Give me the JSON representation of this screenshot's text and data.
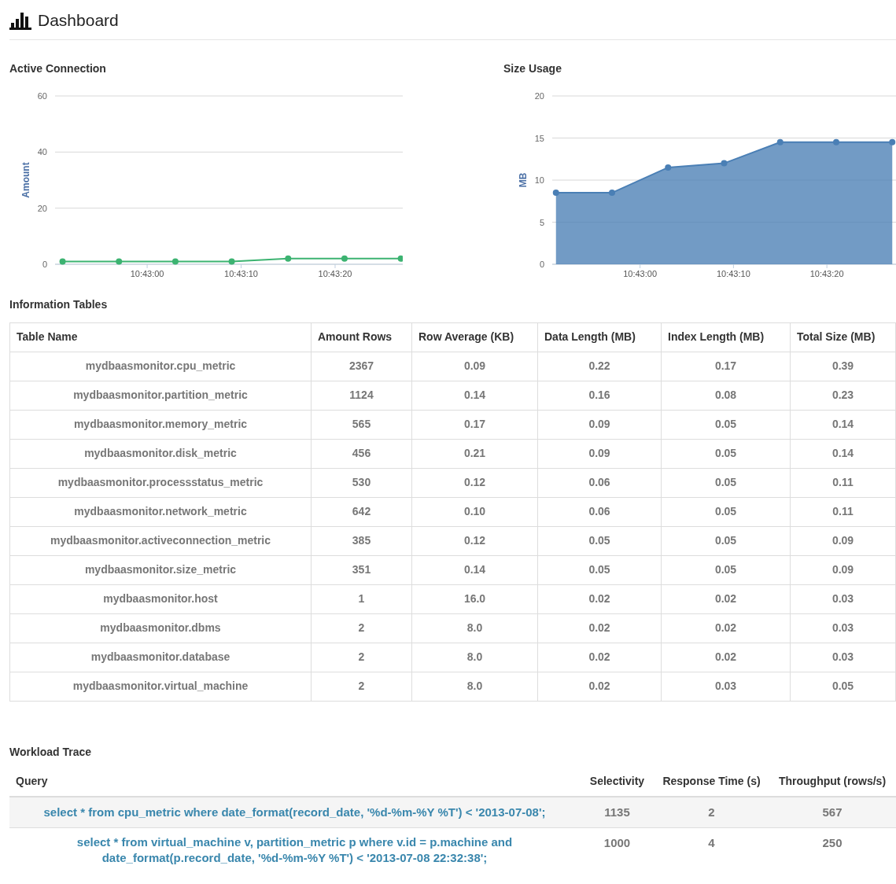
{
  "page": {
    "title": "Dashboard"
  },
  "active_connection": {
    "title": "Active Connection",
    "chart_data": {
      "type": "line",
      "ylabel": "Amount",
      "grid": true,
      "x": [
        38571,
        38577,
        38583,
        38589,
        38595,
        38601,
        38607
      ],
      "xlim": [
        38570.2,
        38607.2
      ],
      "ylim": [
        0,
        60
      ],
      "yticks": [
        0,
        20,
        40,
        60
      ],
      "xticks": [
        {
          "value": 38580,
          "label": "10:43:00"
        },
        {
          "value": 38590,
          "label": "10:43:10"
        },
        {
          "value": 38600,
          "label": "10:43:20"
        }
      ],
      "series": [
        {
          "marker": true,
          "color": "#3cb371",
          "values": [
            1,
            1,
            1,
            1,
            2,
            2,
            2
          ]
        }
      ]
    }
  },
  "size_usage": {
    "title": "Size Usage",
    "chart_data": {
      "type": "area",
      "ylabel": "MB",
      "grid": true,
      "x": [
        38571,
        38577,
        38583,
        38589,
        38595,
        38601,
        38607
      ],
      "xlim": [
        38570.6,
        38607.4
      ],
      "ylim": [
        0,
        20
      ],
      "yticks": [
        0,
        5,
        10,
        15,
        20
      ],
      "xticks": [
        {
          "value": 38580,
          "label": "10:43:00"
        },
        {
          "value": 38590,
          "label": "10:43:10"
        },
        {
          "value": 38600,
          "label": "10:43:20"
        }
      ],
      "series": [
        {
          "marker": true,
          "color": "#4a7fb5",
          "values": [
            8.5,
            8.5,
            11.5,
            12,
            14.5,
            14.5,
            14.5
          ]
        }
      ]
    }
  },
  "information_tables": {
    "title": "Information Tables",
    "columns": [
      "Table Name",
      "Amount Rows",
      "Row Average (KB)",
      "Data Length (MB)",
      "Index Length (MB)",
      "Total Size (MB)"
    ],
    "rows": [
      [
        "mydbaasmonitor.cpu_metric",
        "2367",
        "0.09",
        "0.22",
        "0.17",
        "0.39"
      ],
      [
        "mydbaasmonitor.partition_metric",
        "1124",
        "0.14",
        "0.16",
        "0.08",
        "0.23"
      ],
      [
        "mydbaasmonitor.memory_metric",
        "565",
        "0.17",
        "0.09",
        "0.05",
        "0.14"
      ],
      [
        "mydbaasmonitor.disk_metric",
        "456",
        "0.21",
        "0.09",
        "0.05",
        "0.14"
      ],
      [
        "mydbaasmonitor.processstatus_metric",
        "530",
        "0.12",
        "0.06",
        "0.05",
        "0.11"
      ],
      [
        "mydbaasmonitor.network_metric",
        "642",
        "0.10",
        "0.06",
        "0.05",
        "0.11"
      ],
      [
        "mydbaasmonitor.activeconnection_metric",
        "385",
        "0.12",
        "0.05",
        "0.05",
        "0.09"
      ],
      [
        "mydbaasmonitor.size_metric",
        "351",
        "0.14",
        "0.05",
        "0.05",
        "0.09"
      ],
      [
        "mydbaasmonitor.host",
        "1",
        "16.0",
        "0.02",
        "0.02",
        "0.03"
      ],
      [
        "mydbaasmonitor.dbms",
        "2",
        "8.0",
        "0.02",
        "0.02",
        "0.03"
      ],
      [
        "mydbaasmonitor.database",
        "2",
        "8.0",
        "0.02",
        "0.02",
        "0.03"
      ],
      [
        "mydbaasmonitor.virtual_machine",
        "2",
        "8.0",
        "0.02",
        "0.03",
        "0.05"
      ]
    ]
  },
  "workload_trace": {
    "title": "Workload Trace",
    "columns": [
      "Query",
      "Selectivity",
      "Response Time (s)",
      "Throughput (rows/s)"
    ],
    "rows": [
      {
        "query": "select * from cpu_metric where date_format(record_date, '%d-%m-%Y %T') < '2013-07-08';",
        "selectivity": "1135",
        "response_time": "2",
        "throughput": "567"
      },
      {
        "query": "select * from virtual_machine v, partition_metric p where v.id = p.machine and date_format(p.record_date, '%d-%m-%Y %T') < '2013-07-08 22:32:38';",
        "selectivity": "1000",
        "response_time": "4",
        "throughput": "250"
      }
    ]
  }
}
